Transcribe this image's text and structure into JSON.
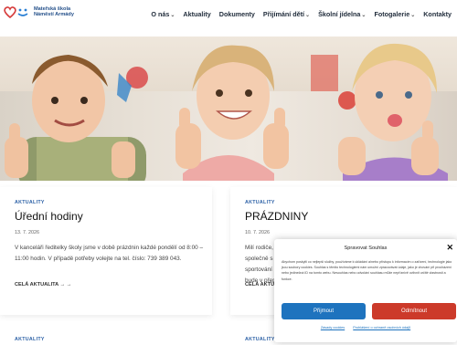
{
  "header": {
    "logo_line1": "Mateřská škola",
    "logo_line2": "Náměstí Armády",
    "nav": [
      {
        "label": "O nás",
        "has_dropdown": true
      },
      {
        "label": "Aktuality",
        "has_dropdown": false
      },
      {
        "label": "Dokumenty",
        "has_dropdown": false
      },
      {
        "label": "Přijímání dětí",
        "has_dropdown": true
      },
      {
        "label": "Školní jídelna",
        "has_dropdown": true
      },
      {
        "label": "Fotogalerie",
        "has_dropdown": true
      },
      {
        "label": "Kontakty",
        "has_dropdown": false
      }
    ],
    "chevron": "⌄"
  },
  "posts": [
    {
      "category": "AKTUALITY",
      "title": "Úřední hodiny",
      "date": "13. 7. 2026",
      "excerpt": "V kanceláři ředitelky školy jsme v době prázdnin každé pondělí od 8:00 – 11:00 hodin. V případě potřeby volejte na tel. číslo: 739 389 043.",
      "more": "CELÁ AKTUALITA → →"
    },
    {
      "category": "AKTUALITY",
      "title": "PRÁZDNINY",
      "date": "10. 7. 2026",
      "excerpt": "Milí rodiče, společně s sportování bude v přep",
      "more": "CELÁ AKTU"
    }
  ],
  "posts_row2": [
    {
      "category": "AKTUALITY"
    },
    {
      "category": "AKTUALITY"
    }
  ],
  "cookie": {
    "title": "Spravovat Souhlas",
    "close": "✕",
    "text": "Abychom poskytli co nejlepší služby, používáme k ukládání a/nebo přístupu k informacím o zařízení, technologie jako jsou soubory cookies. Souhlas s těmito technologiemi nám umožní zpracovávat údaje, jako je chování při procházení nebo jedinečná ID na tomto webu. Nesouhlas nebo odvolání souhlasu může nepříznivě ovlivnit určité vlastnosti a funkce.",
    "accept": "Přijmout",
    "deny": "Odmítnout",
    "link1": "Zásady cookies",
    "link2": "Prohlášení o ochraně osobních údajů"
  },
  "colors": {
    "brand_blue": "#24508a",
    "accept": "#1e73be",
    "deny": "#cc3a2a",
    "logo_red": "#d63a3a"
  }
}
